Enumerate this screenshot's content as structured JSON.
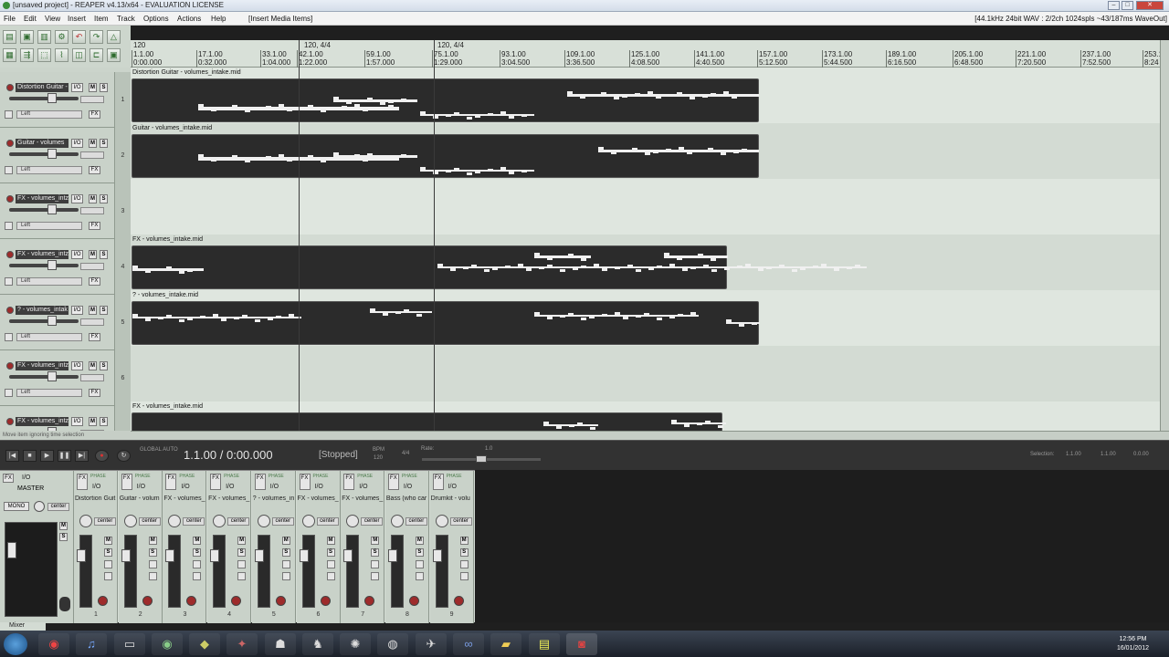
{
  "window": {
    "title": "[unsaved project] - REAPER v4.13/x64 - EVALUATION LICENSE"
  },
  "menu": {
    "items": [
      "File",
      "Edit",
      "View",
      "Insert",
      "Item",
      "Track",
      "Options",
      "Actions",
      "Help"
    ],
    "mode": "[Insert Media Items]",
    "status": "[44.1kHz 24bit WAV : 2/2ch 1024spls ~43/187ms WaveOut]"
  },
  "ruler": {
    "markers": [
      "120",
      "120, 4/4",
      "120, 4/4"
    ],
    "bars": [
      {
        "bar": "1.1.00",
        "time": "0:00.000"
      },
      {
        "bar": "17.1.00",
        "time": "0:32.000"
      },
      {
        "bar": "33.1.00",
        "time": "1:04.000"
      },
      {
        "bar": "42.1.00",
        "time": "1:22.000"
      },
      {
        "bar": "59.1.00",
        "time": "1:57.000"
      },
      {
        "bar": "75.1.00",
        "time": "1:29.000"
      },
      {
        "bar": "93.1.00",
        "time": "3:04.500"
      },
      {
        "bar": "109.1.00",
        "time": "3:36.500"
      },
      {
        "bar": "125.1.00",
        "time": "4:08.500"
      },
      {
        "bar": "141.1.00",
        "time": "4:40.500"
      },
      {
        "bar": "157.1.00",
        "time": "5:12.500"
      },
      {
        "bar": "173.1.00",
        "time": "5:44.500"
      },
      {
        "bar": "189.1.00",
        "time": "6:16.500"
      },
      {
        "bar": "205.1.00",
        "time": "6:48.500"
      },
      {
        "bar": "221.1.00",
        "time": "7:20.500"
      },
      {
        "bar": "237.1.00",
        "time": "7:52.500"
      },
      {
        "bar": "253.1",
        "time": "8:24"
      }
    ]
  },
  "tracks": [
    {
      "name": "Distortion Guitar -",
      "num": "1",
      "pan": "Left",
      "io": "I/O",
      "m": "M",
      "s": "S",
      "fx": "FX",
      "item": "Distortion Guitar - volumes_intake.mid"
    },
    {
      "name": "Guitar - volumes",
      "num": "2",
      "pan": "Left",
      "io": "I/O",
      "m": "M",
      "s": "S",
      "fx": "FX",
      "item": "Guitar - volumes_intake.mid"
    },
    {
      "name": "FX - volumes_intz",
      "num": "3",
      "pan": "Left",
      "io": "I/O",
      "m": "M",
      "s": "S",
      "fx": "FX",
      "item": ""
    },
    {
      "name": "FX - volumes_intz",
      "num": "4",
      "pan": "Left",
      "io": "I/O",
      "m": "M",
      "s": "S",
      "fx": "FX",
      "item": "FX - volumes_intake.mid"
    },
    {
      "name": "? - volumes_intak",
      "num": "5",
      "pan": "Left",
      "io": "I/O",
      "m": "M",
      "s": "S",
      "fx": "FX",
      "item": "? - volumes_intake.mid"
    },
    {
      "name": "FX - volumes_intz",
      "num": "6",
      "pan": "Left",
      "io": "I/O",
      "m": "M",
      "s": "S",
      "fx": "FX",
      "item": ""
    },
    {
      "name": "FX - volumes_intz",
      "num": "7",
      "pan": "Left",
      "io": "I/O",
      "m": "M",
      "s": "S",
      "fx": "FX",
      "item": "FX - volumes_intake.mid"
    }
  ],
  "status_hint": "Move item ignoring time selection",
  "transport": {
    "time": "1.1.00 / 0:00.000",
    "state": "[Stopped]",
    "bpm_label": "BPM",
    "bpm": "120",
    "sig": "4/4",
    "rate_label": "Rate:",
    "rate": "1.0",
    "global_auto": "GLOBAL AUTO",
    "selection_label": "Selection:",
    "sel_start": "1.1.00",
    "sel_end": "1.1.00",
    "sel_len": "0.0.00"
  },
  "mixer": {
    "master": {
      "label": "MASTER",
      "io": "I/O",
      "mono": "MONO",
      "pan": "center",
      "fx": "FX"
    },
    "strips": [
      {
        "label": "Distortion Guit",
        "num": "1"
      },
      {
        "label": "Guitar - volum",
        "num": "2"
      },
      {
        "label": "FX - volumes_",
        "num": "3"
      },
      {
        "label": "FX - volumes_",
        "num": "4"
      },
      {
        "label": "? - volumes_in",
        "num": "5"
      },
      {
        "label": "FX - volumes_",
        "num": "6"
      },
      {
        "label": "FX - volumes_",
        "num": "7"
      },
      {
        "label": "Bass (who car",
        "num": "8"
      },
      {
        "label": "Drumkit - volu",
        "num": "9"
      }
    ],
    "strip_io": "I/O",
    "strip_pan": "center",
    "strip_fx": "FX",
    "phase": "PHASE",
    "btn_m": "M",
    "btn_s": "S",
    "tab": "Mixer"
  },
  "taskbar": {
    "time": "12:56 PM",
    "date": "16/01/2012"
  },
  "colors": {
    "record": "#9e2b2b",
    "arrange_bg": "#dfe6df",
    "item_bg": "#2b2b2b"
  }
}
